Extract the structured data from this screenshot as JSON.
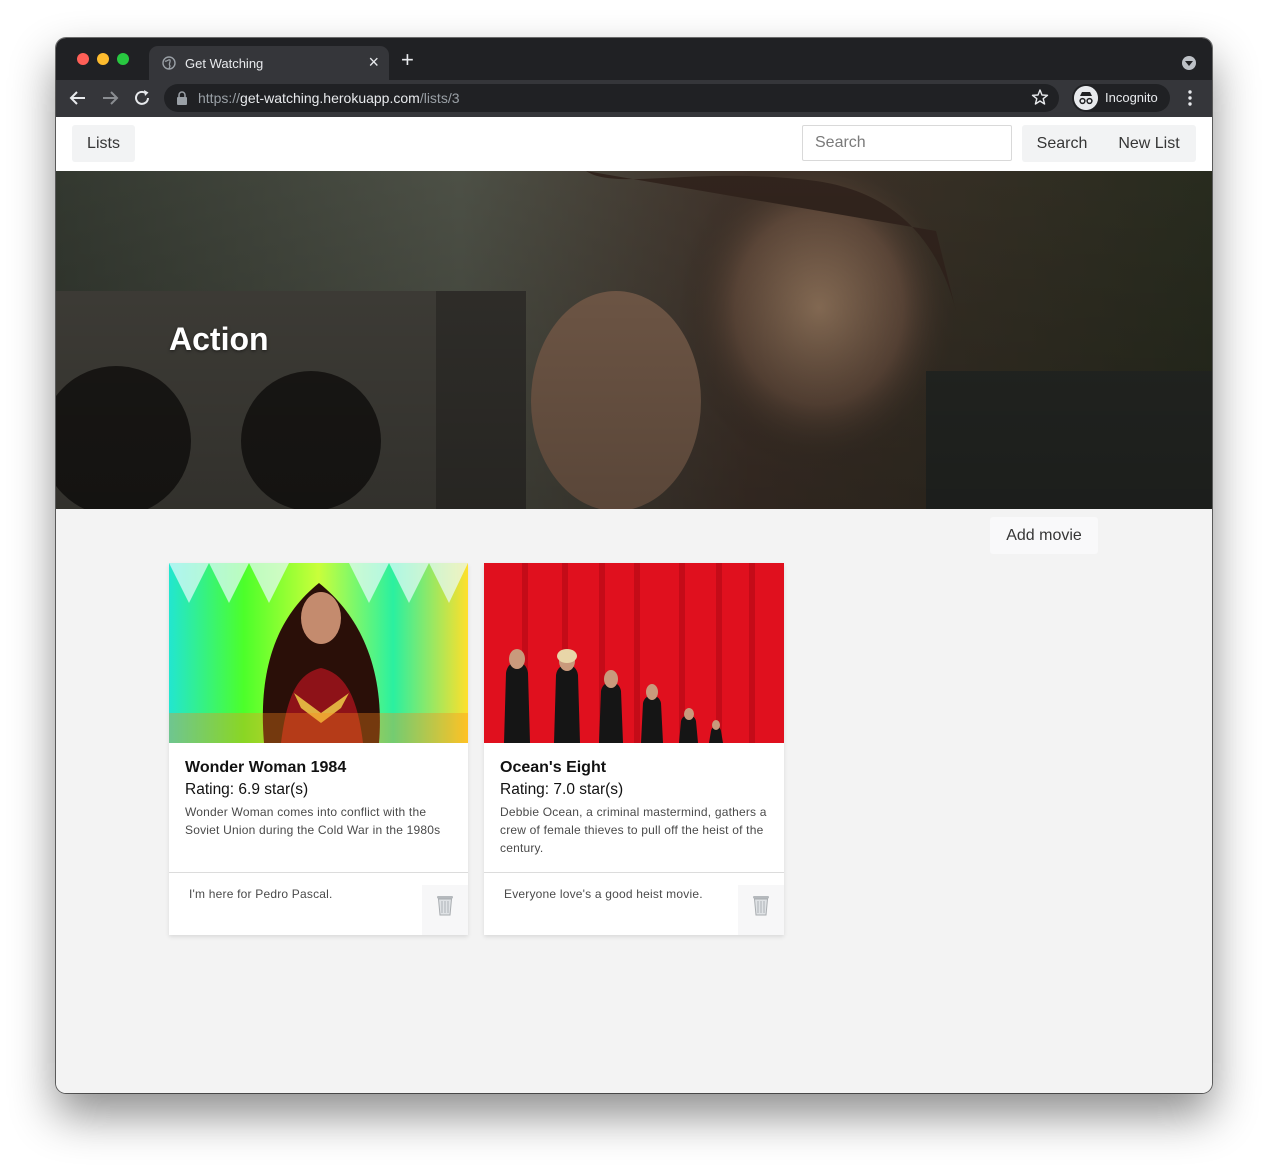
{
  "browser": {
    "tab_title": "Get Watching",
    "tab_close": "×",
    "new_tab": "+",
    "url_scheme": "https://",
    "url_host": "get-watching.herokuapp.com",
    "url_path": "/lists/3",
    "profile_label": "Incognito",
    "icons": {
      "back": "back-arrow-icon",
      "forward": "forward-arrow-icon",
      "reload": "reload-icon",
      "lock": "lock-icon",
      "bookmark": "star-icon",
      "menu": "kebab-menu-icon"
    }
  },
  "navbar": {
    "lists_label": "Lists",
    "search_placeholder": "Search",
    "search_label": "Search",
    "new_list_label": "New List"
  },
  "list": {
    "title": "Action",
    "add_movie_label": "Add movie"
  },
  "movies": [
    {
      "title": "Wonder Woman 1984",
      "rating": "Rating: 6.9 star(s)",
      "description": "Wonder Woman comes into conflict with the Soviet Union during the Cold War in the 1980s",
      "comment": "I'm here for Pedro Pascal."
    },
    {
      "title": "Ocean's Eight",
      "rating": "Rating: 7.0 star(s)",
      "description": "Debbie Ocean, a criminal mastermind, gathers a crew of female thieves to pull off the heist of the century.",
      "comment": "Everyone love's a good heist movie."
    }
  ],
  "colors": {
    "chrome_dark": "#202124",
    "chrome_tab": "#35363a",
    "page_bg": "#f3f3f3",
    "button_bg": "#f2f3f4",
    "poster_red": "#e0101e"
  }
}
